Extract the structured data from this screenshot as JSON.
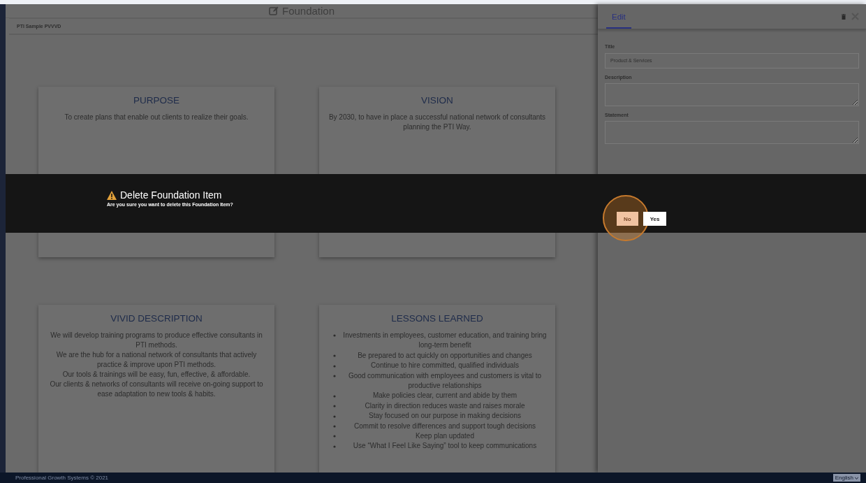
{
  "header": {
    "title": "Foundation"
  },
  "plan_name": "PTI Sample PVVVD",
  "cards": [
    {
      "kind": "text",
      "title": "PURPOSE",
      "lines": [
        "To create plans that enable out clients to realize their goals."
      ]
    },
    {
      "kind": "text",
      "title": "VISION",
      "lines": [
        "By 2030, to have in place a successful national network of consultants planning the PTI Way."
      ]
    },
    {
      "kind": "text",
      "title": "VIVID DESCRIPTION",
      "lines": [
        "We will develop training programs to produce effective consultants in PTI methods.",
        "We are the hub for a national network of consultants that actively practice & improve upon PTI methods.",
        "Our tools & trainings will be easy, fun, effective, & affordable.",
        "Our clients & networks of consultants will receive on-going support to ease adaptation to new tools & habits."
      ]
    },
    {
      "kind": "list",
      "title": "LESSONS LEARNED",
      "lines": [
        "Investments in employees, customer education, and training bring long-term benefit",
        "Be prepared to act quickly on opportunities and changes",
        "Continue to hire committed, qualified individuals",
        "Good communication with employees and customers is vital to productive relationships",
        "Make policies clear, current and abide by them",
        "Clarity in direction reduces waste and raises morale",
        "Stay focused on our purpose in making decisions",
        "Commit to resolve differences and support tough decisions",
        "Keep plan updated",
        "Use “What I Feel Like Saying” tool to keep communications"
      ]
    }
  ],
  "edit_panel": {
    "tabs": [
      {
        "label": "Edit",
        "selected": true
      }
    ],
    "fields": [
      {
        "kind": "input",
        "label": "Title",
        "value": "Product & Services"
      },
      {
        "kind": "textarea",
        "label": "Description"
      },
      {
        "kind": "textarea",
        "label": "Statement"
      }
    ]
  },
  "dialog": {
    "title": "Delete Foundation Item",
    "message": "Are you sure you want to delete this Foundation Item?",
    "buttons": [
      {
        "label": "No",
        "highlighted": true
      },
      {
        "label": "Yes",
        "highlighted": false
      }
    ]
  },
  "footer": {
    "copyright": "Professional Growth Systems © 2021",
    "language": "English"
  }
}
